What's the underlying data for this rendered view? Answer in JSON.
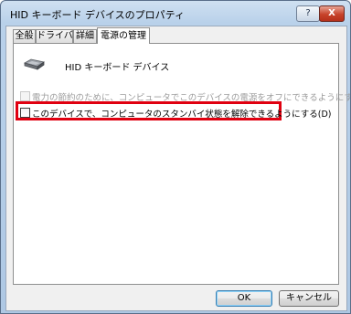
{
  "window": {
    "title": "HID キーボード デバイスのプロパティ",
    "help_label": "?",
    "close_label": "X"
  },
  "tabs": [
    {
      "label": "全般",
      "active": false
    },
    {
      "label": "ドライバ",
      "active": false
    },
    {
      "label": "詳細",
      "active": false
    },
    {
      "label": "電源の管理",
      "active": true
    }
  ],
  "device": {
    "icon": "keyboard-icon",
    "name": "HID キーボード デバイス"
  },
  "options": [
    {
      "label": "電力の節約のために、コンピュータでこのデバイスの電源をオフにできるようにする(C)",
      "checked": false,
      "enabled": false
    },
    {
      "label": "このデバイスで、コンピュータのスタンバイ状態を解除できるようにする(D)",
      "checked": false,
      "enabled": true
    }
  ],
  "highlight_color": "#e00010",
  "buttons": {
    "ok": "OK",
    "cancel": "キャンセル"
  }
}
